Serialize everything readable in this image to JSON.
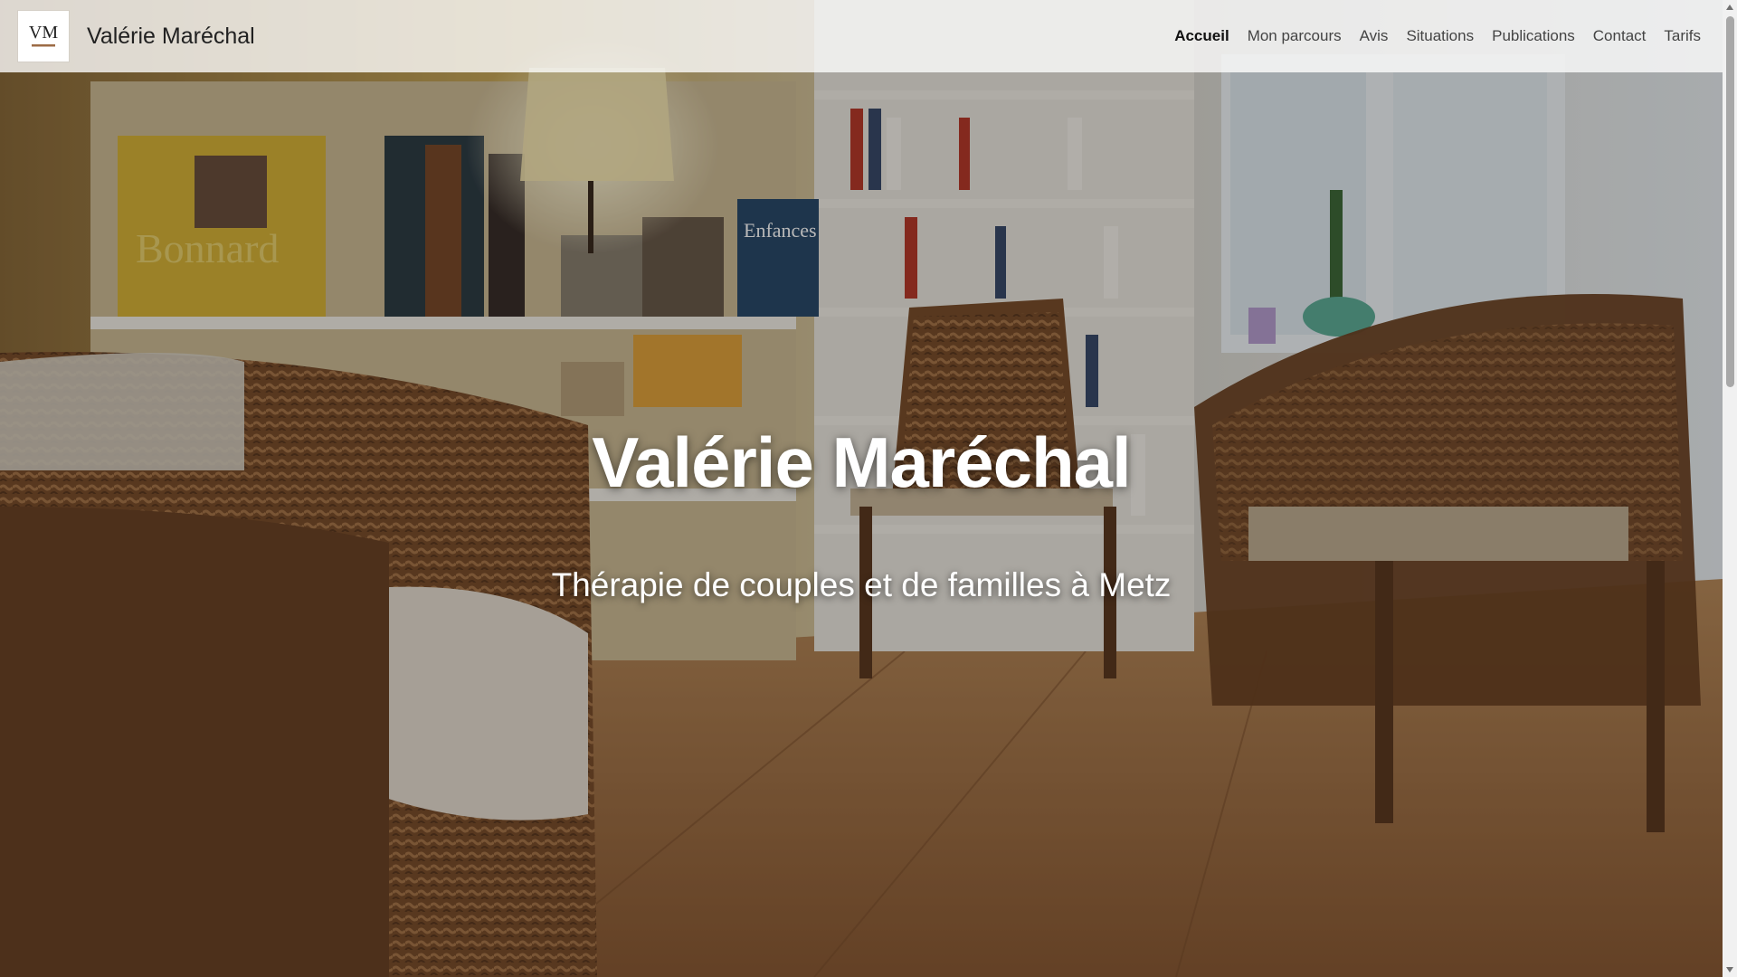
{
  "site": {
    "brand": "Valérie Maréchal",
    "logo_text": "VM"
  },
  "nav": {
    "items": [
      {
        "label": "Accueil",
        "active": true
      },
      {
        "label": "Mon parcours",
        "active": false
      },
      {
        "label": "Avis",
        "active": false
      },
      {
        "label": "Situations",
        "active": false
      },
      {
        "label": "Publications",
        "active": false
      },
      {
        "label": "Contact",
        "active": false
      },
      {
        "label": "Tarifs",
        "active": false
      }
    ]
  },
  "hero": {
    "title": "Valérie Maréchal",
    "subtitle": "Thérapie de couples et de familles à Metz",
    "image_note": "",
    "book_spine_text": "Bonnard",
    "book_cover_text": "Enfances"
  },
  "colors": {
    "navbar_bg": "#ffffffc7",
    "active_link": "#111111",
    "link": "#444444",
    "hero_text": "#ffffff"
  },
  "scrollbar": {
    "up_icon": "triangle-up",
    "down_icon": "triangle-down"
  }
}
